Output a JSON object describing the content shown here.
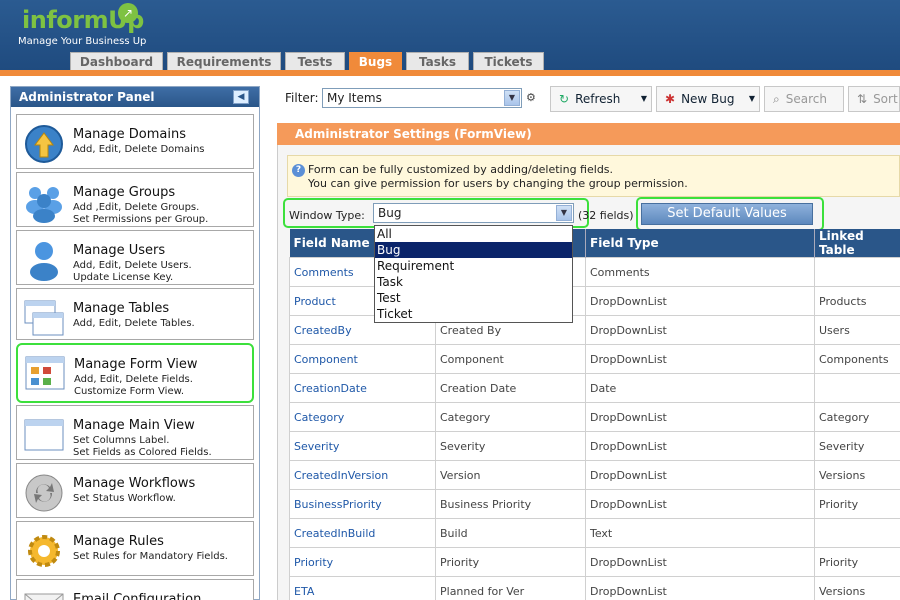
{
  "app": {
    "logo_text": "informUp",
    "tagline": "Manage Your Business Up",
    "tabs": [
      {
        "label": "Dashboard"
      },
      {
        "label": "Requirements"
      },
      {
        "label": "Tests"
      },
      {
        "label": "Bugs",
        "active": true
      },
      {
        "label": "Tasks"
      },
      {
        "label": "Tickets"
      }
    ]
  },
  "admin_panel": {
    "title": "Administrator Panel",
    "items": [
      {
        "title": "Manage Domains",
        "desc": "Add, Edit, Delete Domains",
        "icon": "globe-arrow-icon"
      },
      {
        "title": "Manage Groups",
        "desc": "Add ,Edit, Delete Groups.\nSet Permissions per Group.",
        "icon": "group-users-icon"
      },
      {
        "title": "Manage Users",
        "desc": "Add, Edit, Delete Users.\nUpdate License Key.",
        "icon": "user-icon"
      },
      {
        "title": "Manage Tables",
        "desc": "Add, Edit, Delete Tables.",
        "icon": "tables-icon"
      },
      {
        "title": "Manage Form View",
        "desc": "Add, Edit, Delete Fields.\nCustomize Form View.",
        "icon": "form-view-icon",
        "highlight": true
      },
      {
        "title": "Manage Main View",
        "desc": "Set Columns Label.\nSet Fields as Colored Fields.",
        "icon": "main-view-icon"
      },
      {
        "title": "Manage Workflows",
        "desc": "Set Status Workflow.",
        "icon": "workflow-icon"
      },
      {
        "title": "Manage Rules",
        "desc": "Set Rules for Mandatory Fields.",
        "icon": "gear-rules-icon"
      },
      {
        "title": "Email Configuration",
        "desc": "",
        "icon": "email-icon"
      }
    ]
  },
  "toolbar": {
    "filter_label": "Filter:",
    "filter_value": "My Items",
    "refresh_label": "Refresh",
    "new_bug_label": "New Bug",
    "search_label": "Search",
    "sort_label": "Sort"
  },
  "settings": {
    "title": "Administrator Settings  (FormView)",
    "info_line1": "Form can be fully customized by adding/deleting fields.",
    "info_line2": "You can give permission for users by changing the group permission.",
    "window_type_label": "Window Type:",
    "window_type_value": "Bug",
    "field_count": "(32 fields)",
    "default_button": "Set Default Values",
    "dropdown_options": [
      "All",
      "Bug",
      "Requirement",
      "Task",
      "Test",
      "Ticket"
    ],
    "dropdown_selected": "Bug"
  },
  "table": {
    "headers": [
      "Field Name",
      "",
      "Field Type",
      "Linked Table"
    ],
    "rows": [
      [
        "Comments",
        "",
        "Comments",
        ""
      ],
      [
        "Product",
        "",
        "DropDownList",
        "Products"
      ],
      [
        "CreatedBy",
        "Created By",
        "DropDownList",
        "Users"
      ],
      [
        "Component",
        "Component",
        "DropDownList",
        "Components"
      ],
      [
        "CreationDate",
        "Creation Date",
        "Date",
        ""
      ],
      [
        "Category",
        "Category",
        "DropDownList",
        "Category"
      ],
      [
        "Severity",
        "Severity",
        "DropDownList",
        "Severity"
      ],
      [
        "CreatedInVersion",
        "Version",
        "DropDownList",
        "Versions"
      ],
      [
        "BusinessPriority",
        "Business Priority",
        "DropDownList",
        "Priority"
      ],
      [
        "CreatedInBuild",
        "Build",
        "Text",
        ""
      ],
      [
        "Priority",
        "Priority",
        "DropDownList",
        "Priority"
      ],
      [
        "ETA",
        "Planned for Ver",
        "DropDownList",
        "Versions"
      ]
    ]
  }
}
